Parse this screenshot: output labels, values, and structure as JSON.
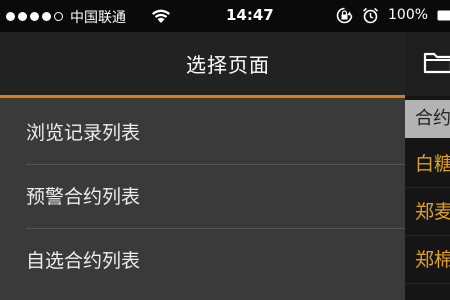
{
  "status_bar": {
    "carrier": "中国联通",
    "time": "14:47",
    "battery": "100%"
  },
  "drawer": {
    "title": "选择页面",
    "items": [
      {
        "label": "浏览记录列表"
      },
      {
        "label": "预警合约列表"
      },
      {
        "label": "自选合约列表"
      }
    ]
  },
  "background_panel": {
    "header_text": "合约",
    "rows": [
      "白糖",
      "郑麦",
      "郑棉"
    ]
  },
  "colors": {
    "accent": "#e07a1c",
    "drawer_bg": "#3a3a3a",
    "row_text": "#e0a020"
  }
}
